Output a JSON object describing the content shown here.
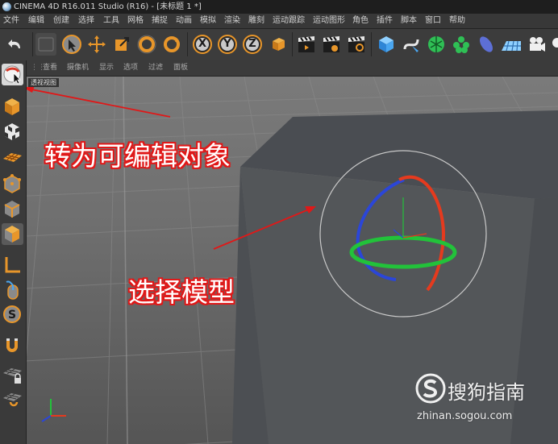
{
  "window": {
    "title": "CINEMA 4D R16.011 Studio (R16) - [未标题 1 *]"
  },
  "menu": [
    "文件",
    "编辑",
    "创建",
    "选择",
    "工具",
    "网格",
    "捕捉",
    "动画",
    "模拟",
    "渲染",
    "雕刻",
    "运动跟踪",
    "运动图形",
    "角色",
    "插件",
    "脚本",
    "窗口",
    "帮助"
  ],
  "axis_buttons": [
    "X",
    "Y",
    "Z"
  ],
  "view_menu": [
    "查看",
    "摄像机",
    "显示",
    "选项",
    "过滤",
    "面板"
  ],
  "viewport": {
    "label": "透视视图"
  },
  "annotations": {
    "convert": "转为可编辑对象",
    "select": "选择模型"
  },
  "watermark": {
    "brand": "搜狗指南",
    "url": "zhinan.sogou.com"
  },
  "colors": {
    "annotation_red": "#e01818",
    "gizmo_red": "#e53a1e",
    "gizmo_green": "#22c23a",
    "gizmo_blue": "#2b46d8",
    "toolbar_orange": "#e8962a"
  }
}
